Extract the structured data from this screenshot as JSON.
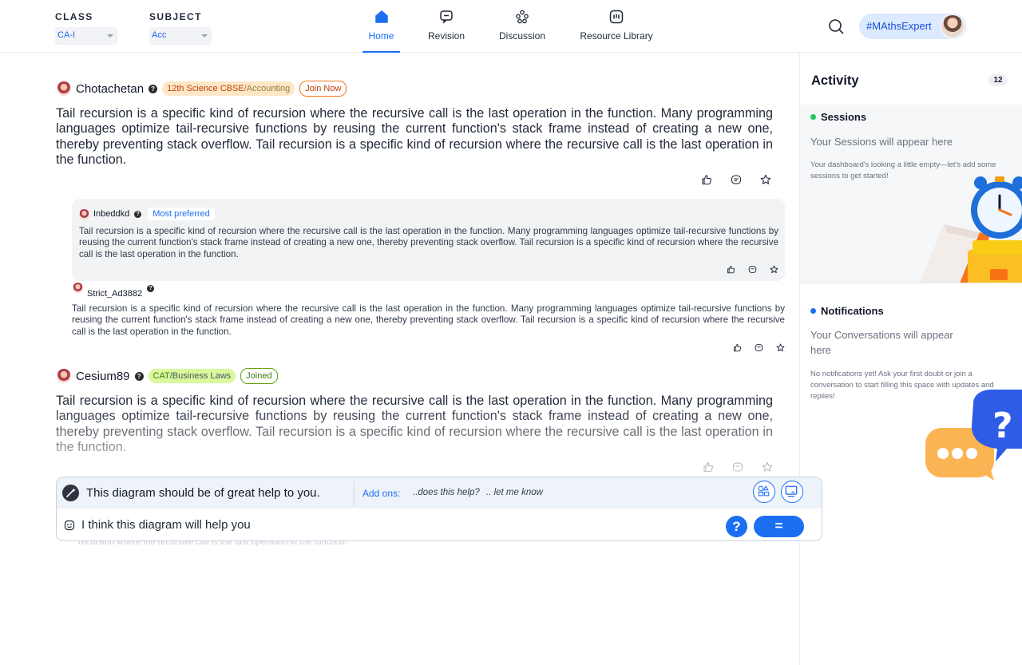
{
  "header": {
    "class": {
      "label": "CLASS",
      "value": "CA-I"
    },
    "subject": {
      "label": "SUBJECT",
      "value": "Acc"
    },
    "nav": [
      {
        "label": "Home",
        "icon": "home-icon",
        "active": true
      },
      {
        "label": "Revision",
        "icon": "chat-bubble-icon"
      },
      {
        "label": "Discussion",
        "icon": "group-icon"
      },
      {
        "label": "Resource Library",
        "icon": "library-icon"
      }
    ],
    "profile_tag": "#MAthsExpert"
  },
  "feed": {
    "post1": {
      "user": "Chotachetan",
      "tag_main": "12th Science CBSE",
      "tag_sub": "/Accounting",
      "action": "Join Now",
      "body": "Tail recursion is a specific kind of recursion where the recursive call is the last operation in the function. Many programming languages optimize tail-recursive functions by reusing the current function's stack frame instead of creating a new one, thereby preventing stack overflow. Tail recursion is a specific kind of recursion where the recursive call is the last operation in the function."
    },
    "reply1": {
      "user": "Inbeddkd",
      "badge": "Most preferred",
      "body": "Tail recursion is a specific kind of recursion where the recursive call is the last operation in the function. Many programming languages optimize tail-recursive functions by reusing the current function's stack frame instead of creating a new one, thereby preventing stack overflow. Tail recursion is a specific kind of recursion where the recursive call is the last operation in the function."
    },
    "reply2": {
      "user": "Strict_Ad3882",
      "body": "Tail recursion is a specific kind of recursion where the recursive call is the last operation in the function. Many programming languages optimize tail-recursive functions by reusing the current function's stack frame instead of creating a new one, thereby preventing stack overflow. Tail recursion is a specific kind of recursion where the recursive call is the last operation in the function."
    },
    "post2": {
      "user": "Cesium89",
      "tag_main": "CAT",
      "tag_sub": "/Business Laws",
      "action": "Joined",
      "body": "Tail recursion is a specific kind of recursion where the recursive call is the last operation in the function. Many programming languages optimize tail-recursive functions by reusing the current function's stack frame instead of creating a new one, thereby preventing stack overflow. Tail recursion is a specific kind of recursion where the recursive call is the last operation in the function."
    },
    "ghost_line": "recursion where the recursive call is the last operation in the function."
  },
  "compose": {
    "suggestion": "This diagram should be of great help to you.",
    "addons_label": "Add ons:",
    "addons": [
      "..does this help?",
      ".. let me know"
    ],
    "input_value": "I think this diagram will help you",
    "help_label": "?",
    "send_label": "= ="
  },
  "activity": {
    "title": "Activity",
    "count": "12",
    "sessions": {
      "title": "Sessions",
      "heading": "Your Sessions will appear here",
      "body": "Your dashboard's looking a little empty—let's add some sessions to get started!"
    },
    "notifications": {
      "title": "Notifications",
      "heading": "Your Conversations will appear here",
      "body": "No notifications yet! Ask your first doubt or join a conversation to start filling this space with updates and replies!"
    }
  },
  "colors": {
    "accent": "#1d6ff2",
    "sessions_dot": "#22c55e",
    "notifications_dot": "#1d6ff2"
  }
}
